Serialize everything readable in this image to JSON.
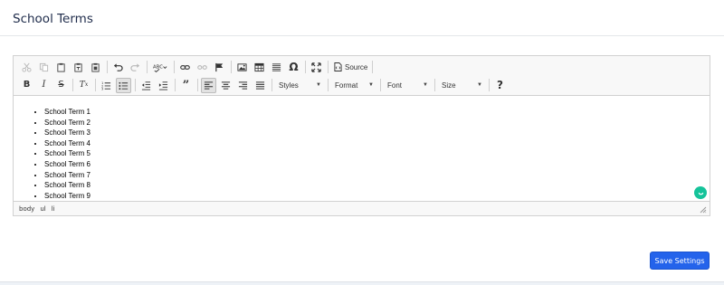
{
  "card": {
    "title": "School Terms"
  },
  "toolbar": {
    "row1": [
      {
        "name": "cut-icon",
        "glyph": "✂",
        "disabled": true
      },
      {
        "name": "copy-icon",
        "glyph": "⧉",
        "disabled": true
      },
      {
        "name": "paste-icon",
        "glyph": "📋",
        "disabled": false
      },
      {
        "name": "paste-text-icon",
        "glyph": "📋",
        "disabled": false
      },
      {
        "name": "paste-word-icon",
        "glyph": "📋",
        "disabled": false
      },
      {
        "name": "undo-icon",
        "glyph": "↶",
        "disabled": false
      },
      {
        "name": "redo-icon",
        "glyph": "↷",
        "disabled": true
      },
      {
        "name": "spellcheck-icon",
        "glyph": "ᴬᴮᶜ",
        "disabled": false
      },
      {
        "name": "link-icon",
        "glyph": "⛓",
        "disabled": false
      },
      {
        "name": "unlink-icon",
        "glyph": "⛓",
        "disabled": true
      },
      {
        "name": "anchor-flag-icon",
        "glyph": "⚑",
        "disabled": false
      },
      {
        "name": "image-icon",
        "glyph": "🖼",
        "disabled": false
      },
      {
        "name": "table-icon",
        "glyph": "▦",
        "disabled": false
      },
      {
        "name": "horizontal-line-icon",
        "glyph": "☰",
        "disabled": false
      },
      {
        "name": "special-char-icon",
        "glyph": "Ω",
        "disabled": false
      },
      {
        "name": "maximize-icon",
        "glyph": "⤢",
        "disabled": false
      }
    ],
    "source_label": "Source",
    "row2": [
      {
        "name": "bold-icon",
        "glyph": "B"
      },
      {
        "name": "italic-icon",
        "glyph": "I"
      },
      {
        "name": "strikethrough-icon",
        "glyph": "S"
      },
      {
        "name": "remove-format-icon",
        "glyph": "Tx"
      },
      {
        "name": "numbered-list-icon",
        "glyph": "1≡"
      },
      {
        "name": "bulleted-list-icon",
        "glyph": "•≡"
      },
      {
        "name": "outdent-icon",
        "glyph": "⇤"
      },
      {
        "name": "indent-icon",
        "glyph": "⇥"
      },
      {
        "name": "blockquote-icon",
        "glyph": "❞"
      },
      {
        "name": "align-left-icon",
        "glyph": "≡"
      },
      {
        "name": "align-center-icon",
        "glyph": "≡"
      },
      {
        "name": "align-right-icon",
        "glyph": "≡"
      },
      {
        "name": "align-justify-icon",
        "glyph": "≡"
      }
    ],
    "combos": {
      "styles": "Styles",
      "format": "Format",
      "font": "Font",
      "size": "Size"
    },
    "help_label": "?"
  },
  "editor": {
    "items": [
      "School Term 1",
      "School Term 2",
      "School Term 3",
      "School Term 4",
      "School Term 5",
      "School Term 6",
      "School Term 7",
      "School Term 8",
      "School Term 9"
    ],
    "path": [
      "body",
      "ul",
      "li"
    ]
  },
  "actions": {
    "save_label": "Save Settings"
  },
  "colors": {
    "primary": "#2463eb",
    "grammarly": "#15c39a",
    "title": "#1e2b4a"
  }
}
